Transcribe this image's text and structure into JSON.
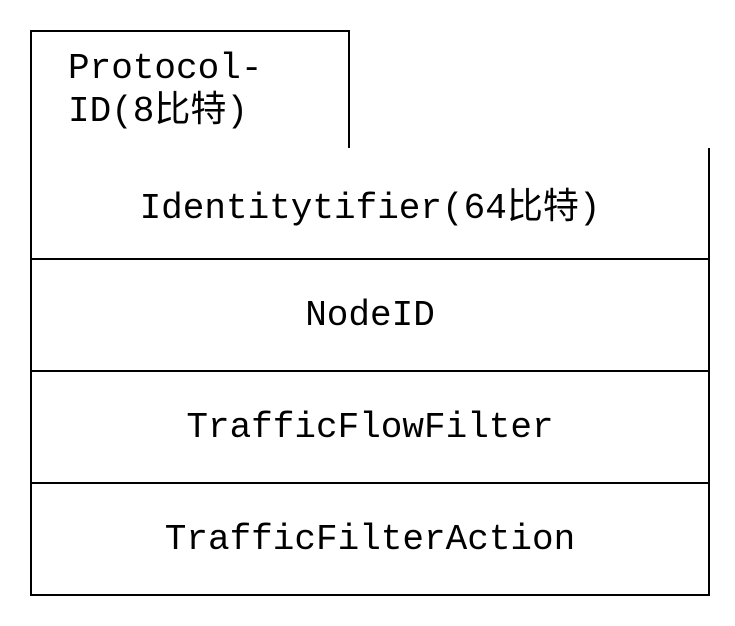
{
  "diagram": {
    "header": {
      "label": "Protocol-ID(8比特)"
    },
    "rows": [
      {
        "label": "Identitytifier(64比特)"
      },
      {
        "label": "NodeID"
      },
      {
        "label": "TrafficFlowFilter"
      },
      {
        "label": "TrafficFilterAction"
      }
    ]
  }
}
